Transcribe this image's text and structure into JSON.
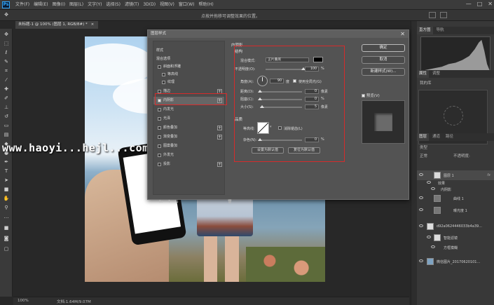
{
  "app": {
    "logo": "Ps",
    "menu": [
      "文件(F)",
      "编辑(E)",
      "图像(I)",
      "图层(L)",
      "文字(Y)",
      "选择(S)",
      "滤镜(T)",
      "3D(D)",
      "视图(V)",
      "窗口(W)",
      "帮助(H)"
    ],
    "window_controls": [
      "—",
      "□",
      "✕"
    ]
  },
  "options_bar": {
    "hint": "点按并拖移可调整效果的位置。"
  },
  "document": {
    "tab_title": "未标题-1 @ 100% (图层 1, RGB/8#) *",
    "tab_close": "×",
    "zoom": "100%",
    "doc_info": "文档:1.64M/9.07M"
  },
  "watermark": "www.haoyi...hejl...com",
  "layer_style_dialog": {
    "title": "图层样式",
    "close": "✕",
    "styles_header": "样式",
    "blend_options": "混合选项",
    "items": [
      {
        "label": "斜面和浮雕",
        "checked": false,
        "plus": false,
        "indent": 1
      },
      {
        "label": "等高线",
        "checked": false,
        "plus": false,
        "indent": 2
      },
      {
        "label": "纹理",
        "checked": false,
        "plus": false,
        "indent": 2
      },
      {
        "label": "描边",
        "checked": false,
        "plus": true,
        "indent": 1
      },
      {
        "label": "内阴影",
        "checked": true,
        "plus": true,
        "indent": 1
      },
      {
        "label": "内发光",
        "checked": false,
        "plus": false,
        "indent": 1
      },
      {
        "label": "光泽",
        "checked": false,
        "plus": false,
        "indent": 1
      },
      {
        "label": "颜色叠加",
        "checked": false,
        "plus": true,
        "indent": 1
      },
      {
        "label": "渐变叠加",
        "checked": false,
        "plus": true,
        "indent": 1
      },
      {
        "label": "图案叠加",
        "checked": false,
        "plus": false,
        "indent": 1
      },
      {
        "label": "外发光",
        "checked": false,
        "plus": false,
        "indent": 1
      },
      {
        "label": "投影",
        "checked": false,
        "plus": true,
        "indent": 1
      }
    ],
    "footer_icons": [
      "fx",
      "↑",
      "↓",
      "🗑"
    ],
    "section_title": "内阴影",
    "structure_title": "结构",
    "blend_mode_label": "混合模式:",
    "blend_mode_value": "正片叠底",
    "shadow_color": "#000000",
    "opacity_label": "不透明度(O):",
    "opacity_value": "100",
    "opacity_fraction": 1.0,
    "percent": "%",
    "angle_label": "角度(A):",
    "angle_value": "90",
    "degree": "度",
    "global_light_label": "使用全局光(G)",
    "global_light_checked": true,
    "distance_label": "距离(D):",
    "distance_value": "0",
    "pixel_unit": "像素",
    "choke_label": "阻塞(C):",
    "choke_value": "0",
    "size_label": "大小(S):",
    "size_value": "5",
    "quality_title": "品质",
    "contour_label": "等高线:",
    "anti_alias_label": "消除锯齿(L)",
    "anti_alias_checked": false,
    "noise_label": "杂色(N):",
    "noise_value": "0",
    "make_default": "设置为默认值",
    "reset_default": "复位为默认值",
    "ok": "确定",
    "cancel": "取消",
    "new_style": "新建样式(W)...",
    "preview_label": "预览(V)",
    "preview_checked": true,
    "highlight_color": "#d62b2b"
  },
  "right_panels": {
    "top_tabs": [
      "直方图",
      "导航"
    ],
    "mid_tabs": [
      "属性",
      "调整"
    ],
    "mid_label": "我的库",
    "bottom_tabs": [
      "图层",
      "通道",
      "路径"
    ],
    "layer_search": "类型",
    "layer_mode": "正常",
    "layer_opacity_label": "不透明度:",
    "layers": [
      {
        "name": "图层 1",
        "fx": "fx",
        "selected": true
      },
      {
        "name": "效果",
        "fx": "",
        "selected": false
      },
      {
        "name": "内阴影",
        "fx": "",
        "selected": false
      },
      {
        "name": "曲线 1",
        "fx": "",
        "selected": false
      },
      {
        "name": "曝光度 1",
        "fx": "",
        "selected": false
      },
      {
        "name": "d92a0624446033b4a39...",
        "fx": "",
        "selected": false
      },
      {
        "name": "智能滤镜",
        "fx": "",
        "selected": false
      },
      {
        "name": "方框模糊",
        "fx": "",
        "selected": false
      },
      {
        "name": "微信图片_20170620101...",
        "fx": "",
        "selected": false
      }
    ]
  }
}
